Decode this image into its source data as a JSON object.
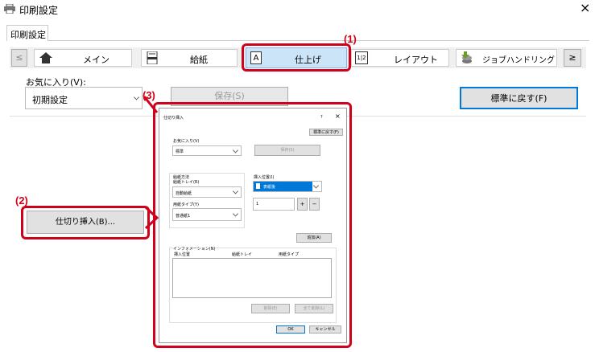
{
  "window": {
    "title": "印刷設定",
    "close": "×"
  },
  "tab": {
    "label": "印刷設定"
  },
  "nav": {
    "prev": "≤",
    "next": "≥",
    "tabs": [
      {
        "label": "メイン",
        "icon": "home-icon"
      },
      {
        "label": "給紙",
        "icon": "paper-tray-icon"
      },
      {
        "label": "仕上げ",
        "icon": "finishing-icon"
      },
      {
        "label": "レイアウト",
        "icon": "layout-icon"
      },
      {
        "label": "ジョブハンドリング",
        "icon": "job-handling-icon"
      }
    ],
    "selected": "仕上げ",
    "layout_icon_text": "1|2",
    "finish_icon_text": "A"
  },
  "favorites": {
    "label": "お気に入り(V):",
    "value": "初期設定",
    "save": "保存(S)",
    "reset": "標準に戻す(F)"
  },
  "main": {
    "insert_button": "仕切り挿入(B)..."
  },
  "callouts": {
    "c1": "(1)",
    "c2": "(2)",
    "c3": "(3)"
  },
  "dialog": {
    "title": "仕切り挿入",
    "help": "?",
    "close": "×",
    "reset": "標準に戻す(F)",
    "fav_label": "お気に入り(V)",
    "fav_value": "標準",
    "save": "保存(S)",
    "paper_method": "給紙方法",
    "tray_label": "給紙トレイ(R)",
    "tray_value": "自動給紙",
    "type_label": "用紙タイプ(Y)",
    "type_value": "普通紙1",
    "insert_pos_label": "挿入位置(I)",
    "insert_pos_value": "表紙後",
    "page_value": "1",
    "plus": "+",
    "minus": "−",
    "add": "追加(A)",
    "info_label": "インフォメーション(N)",
    "col_position": "挿入位置",
    "col_tray": "給紙トレイ",
    "col_type": "用紙タイプ",
    "delete": "削除(E)",
    "delete_all": "全て削除(L)",
    "ok": "OK",
    "cancel": "キャンセル"
  },
  "colors": {
    "accent": "#d0021b",
    "selected_tab": "#cce4f7",
    "dropdown_selected": "#0078d7"
  }
}
